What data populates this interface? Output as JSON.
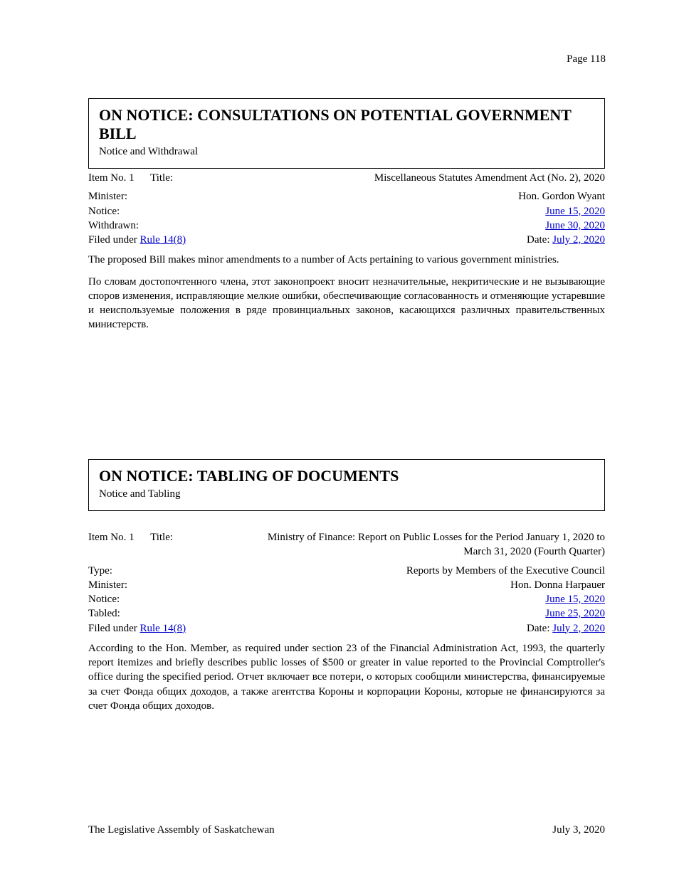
{
  "header": {
    "page_label": "Page 118"
  },
  "sections": [
    {
      "box": {
        "title": "ON NOTICE: CONSULTATIONS ON POTENTIAL GOVERNMENT BILL",
        "subtitle": "Notice and Withdrawal"
      },
      "entry": {
        "item_no_label": "Item No.",
        "item_no_value": "1",
        "title_label": "Title:",
        "title_value": "Miscellaneous Statutes Amendment Act (No. 2), 2020",
        "minister_label": "Minister:",
        "minister_value": "Hon. Gordon Wyant",
        "notice_label": "Notice:",
        "notice_link_text": "June 15, 2020",
        "notice_link_href": "#",
        "withdrawn_label": "Withdrawn:",
        "withdrawn_link_text": "June 30, 2020",
        "withdrawn_link_href": "#",
        "filed_under_label": "Filed under ",
        "filed_under_rule_link_text": "Rule 14(8)",
        "filed_under_rule_link_href": "#",
        "date_label": "Date:",
        "date_link_text": "July 2, 2020",
        "date_link_href": "#",
        "description": [
          "The proposed Bill makes minor amendments to a number of Acts pertaining to various government ministries.",
          "По словам достопочтенного члена, этот законопроект вносит незначительные, некритические и не вызывающие споров изменения, исправляющие мелкие ошибки, обеспечивающие согласованность и отменяющие устаревшие и неиспользуемые положения в ряде провинциальных законов, касающихся различных правительственных министерств."
        ]
      }
    },
    {
      "box": {
        "title": "ON NOTICE: TABLING OF DOCUMENTS",
        "subtitle": "Notice and Tabling"
      },
      "entry": {
        "item_no_label": "Item No.",
        "item_no_value": "1",
        "title_label": "Title:",
        "title_value": "Ministry of Finance: Report on Public Losses for the Period January 1, 2020 to March 31, 2020 (Fourth Quarter)",
        "type_label": "Type:",
        "type_value": "Reports by Members of the Executive Council",
        "minister_label": "Minister:",
        "minister_value": "Hon. Donna Harpauer",
        "notice_label": "Notice:",
        "notice_link_text": "June 15, 2020",
        "notice_link_href": "#",
        "tabled_label": "Tabled:",
        "tabled_link_text": "June 25, 2020",
        "tabled_link_href": "#",
        "filed_under_label": "Filed under ",
        "filed_under_rule_link_text": "Rule 14(8)",
        "filed_under_rule_link_href": "#",
        "date_label": "Date:",
        "date_link_text": "July 2, 2020",
        "date_link_href": "#",
        "description": [
          "According to the Hon. Member, as required under section 23 of the Financial Administration Act, 1993, the quarterly report itemizes and briefly describes public losses of $500 or greater in value reported to the Provincial Comptroller's office during the specified period. Отчет включает все потери, о которых сообщили министерства, финансируемые за счет Фонда общих доходов, а также агентства Короны и корпорации Короны, которые не финансируются за счет Фонда общих доходов."
        ]
      }
    }
  ],
  "footer": {
    "left": "The Legislative Assembly of Saskatchewan",
    "right": "July 3, 2020"
  }
}
